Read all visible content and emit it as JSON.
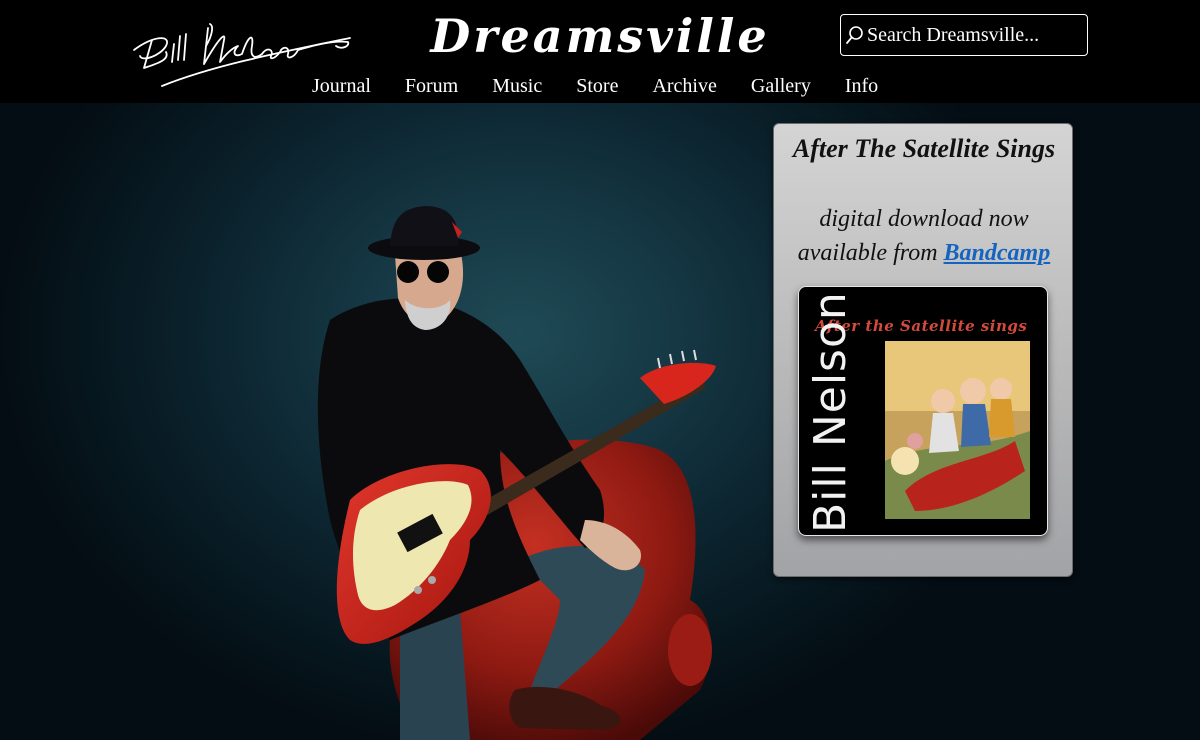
{
  "header": {
    "signature": "Bill Nelson",
    "site_title": "Dreamsville",
    "search": {
      "placeholder": "Search Dreamsville...",
      "icon": "search-icon"
    },
    "nav": [
      {
        "label": "Journal"
      },
      {
        "label": "Forum"
      },
      {
        "label": "Music"
      },
      {
        "label": "Store"
      },
      {
        "label": "Archive"
      },
      {
        "label": "Gallery"
      },
      {
        "label": "Info"
      }
    ]
  },
  "promo": {
    "title": "After The Satellite Sings",
    "line1": "digital download now",
    "line2_prefix": "available from ",
    "link_label": "Bandcamp",
    "album": {
      "title_text": "After the Satellite sings",
      "artist_text": "Bill Nelson"
    }
  },
  "colors": {
    "background": "#000000",
    "hero_teal": "#1f4a55",
    "link": "#1565c0",
    "guitar_red": "#c8221e"
  }
}
